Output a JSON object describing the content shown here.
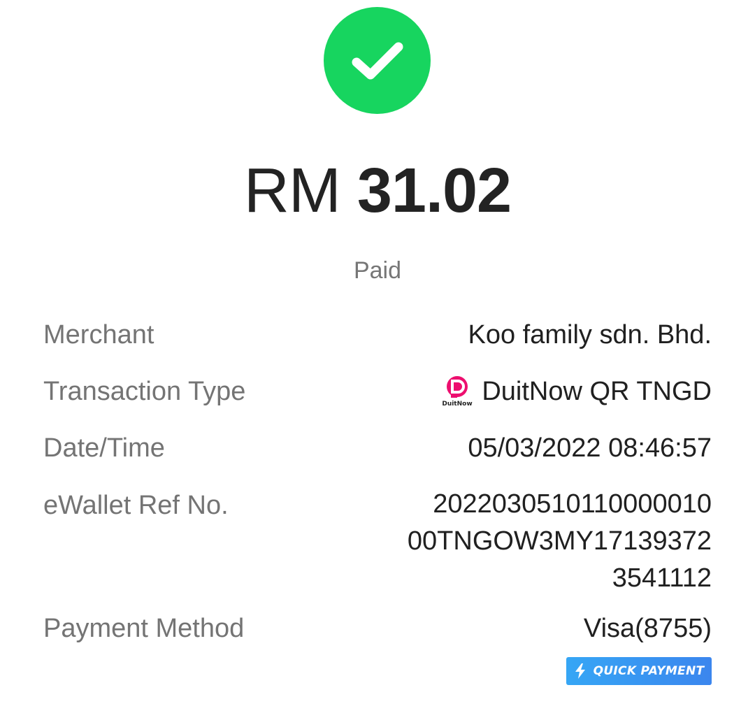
{
  "status_icon": {
    "name": "check-icon",
    "color": "#17d55f"
  },
  "amount": {
    "currency": "RM",
    "value": "31.02"
  },
  "status": "Paid",
  "details": {
    "merchant": {
      "label": "Merchant",
      "value": "Koo family sdn. Bhd."
    },
    "transaction_type": {
      "label": "Transaction Type",
      "value": "DuitNow QR TNGD",
      "icon": "duitnow-logo-icon",
      "icon_text": "DuitNow"
    },
    "date_time": {
      "label": "Date/Time",
      "value": "05/03/2022 08:46:57"
    },
    "ewallet_ref": {
      "label": "eWallet Ref No.",
      "lines": [
        "2022030510110000010",
        "00TNGOW3MY17139372",
        "3541112"
      ]
    },
    "payment_method": {
      "label": "Payment Method",
      "value": "Visa(8755)"
    }
  },
  "quick_payment": {
    "label": "QUICK PAYMENT",
    "icon": "lightning-icon",
    "color": "#3b86ee"
  }
}
